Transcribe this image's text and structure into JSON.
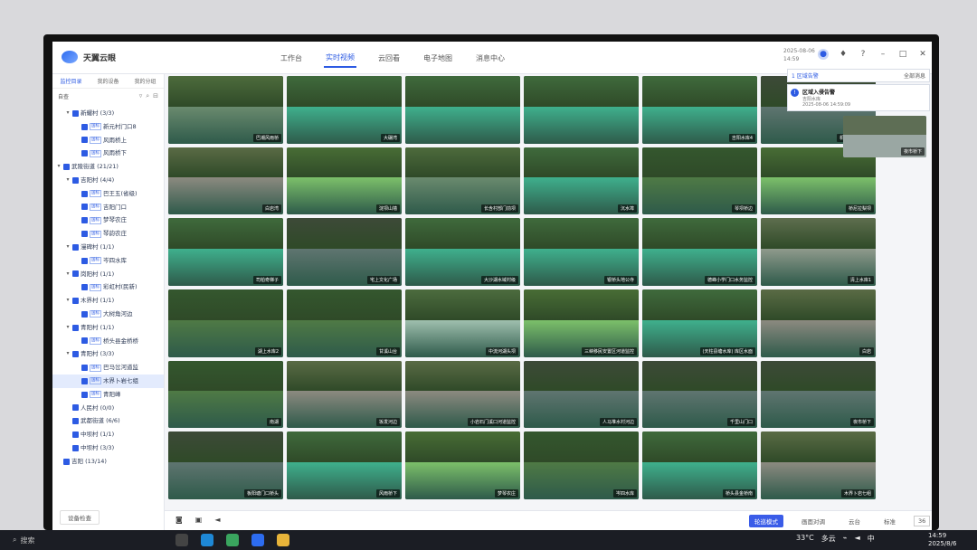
{
  "app": {
    "logo_text": "天翼云眼"
  },
  "nav": {
    "items": [
      {
        "label": "工作台"
      },
      {
        "label": "实时视频",
        "active": true
      },
      {
        "label": "云回看"
      },
      {
        "label": "电子地图"
      },
      {
        "label": "消息中心"
      }
    ]
  },
  "header": {
    "date": "2025-08-06",
    "time": "14:59"
  },
  "sidebar": {
    "tabs": [
      "监控目录",
      "我的设备",
      "我的分组"
    ],
    "search_label": "自查",
    "tree": [
      {
        "label": "新耀村 (3/3)",
        "level": 1,
        "caret": "▾"
      },
      {
        "label": "新元村门口8",
        "level": 2,
        "badge": "国标"
      },
      {
        "label": "风雨桥上",
        "level": 2,
        "badge": "国标"
      },
      {
        "label": "风雨桥下",
        "level": 2,
        "badge": "国标"
      },
      {
        "label": "武陵街道 (21/21)",
        "level": 0,
        "caret": "▾"
      },
      {
        "label": "吉阳村 (4/4)",
        "level": 1,
        "caret": "▾"
      },
      {
        "label": "巴王五(省级)",
        "level": 2,
        "badge": "国标"
      },
      {
        "label": "吉阳门口",
        "level": 2,
        "badge": "国标"
      },
      {
        "label": "梦琴农庄",
        "level": 2,
        "badge": "国标"
      },
      {
        "label": "琴韵农庄",
        "level": 2,
        "badge": "国标"
      },
      {
        "label": "漫碑村 (1/1)",
        "level": 1,
        "caret": "▾"
      },
      {
        "label": "岑四水库",
        "level": 2,
        "badge": "国标"
      },
      {
        "label": "岗阳村 (1/1)",
        "level": 1,
        "caret": "▾"
      },
      {
        "label": "彩虹村(民新)",
        "level": 2,
        "badge": "国标"
      },
      {
        "label": "木界村 (1/1)",
        "level": 1,
        "caret": "▾"
      },
      {
        "label": "大树角河边",
        "level": 2,
        "badge": "国标"
      },
      {
        "label": "青阳村 (1/1)",
        "level": 1,
        "caret": "▾"
      },
      {
        "label": "桥头县金桥桥",
        "level": 2,
        "badge": "国标"
      },
      {
        "label": "青阳村 (3/3)",
        "level": 1,
        "caret": "▾"
      },
      {
        "label": "巴马岔河道监",
        "level": 2,
        "badge": "国标"
      },
      {
        "label": "木界卜岩七组",
        "level": 2,
        "badge": "国标",
        "selected": true
      },
      {
        "label": "青阳峰",
        "level": 2,
        "badge": "国标"
      },
      {
        "label": "人民村 (0/0)",
        "level": 1
      },
      {
        "label": "武都街道 (6/6)",
        "level": 1
      },
      {
        "label": "中坝村 (1/1)",
        "level": 1
      },
      {
        "label": "中坝村 (3/3)",
        "level": 1
      },
      {
        "label": "吉阳 (13/14)",
        "level": 0
      }
    ],
    "footer": "设备检查"
  },
  "tiles": [
    {
      "caption": "巴潮风雨桥",
      "scene": "river"
    },
    {
      "caption": "大碾湾",
      "scene": "lake"
    },
    {
      "caption": "",
      "scene": "lake"
    },
    {
      "caption": "",
      "scene": "lake"
    },
    {
      "caption": "吉阳水库4",
      "scene": "lake"
    },
    {
      "caption": "机耕村河道监控",
      "scene": "dark"
    },
    {
      "caption": "白岩湾",
      "scene": "rock"
    },
    {
      "caption": "淀坝山墙",
      "scene": "green"
    },
    {
      "caption": "长含村部门前坝",
      "scene": "river"
    },
    {
      "caption": "沉水埠",
      "scene": "lake"
    },
    {
      "caption": "琴坝桥边",
      "scene": "forest"
    },
    {
      "caption": "桥尼拉梨坝",
      "scene": "green"
    },
    {
      "caption": "司柏奇梯子",
      "scene": "lake"
    },
    {
      "caption": "宅上文化广场",
      "scene": "dark"
    },
    {
      "caption": "大沙湖水域村级",
      "scene": "lake"
    },
    {
      "caption": "银桥头地公寺",
      "scene": "lake"
    },
    {
      "caption": "德峰小学门口水务监控",
      "scene": "lake"
    },
    {
      "caption": "清上水库1",
      "scene": "bridge"
    },
    {
      "caption": "湖上水库2",
      "scene": "forest"
    },
    {
      "caption": "甘溪山台",
      "scene": "forest"
    },
    {
      "caption": "中流河湖头坝",
      "scene": "dam"
    },
    {
      "caption": "三峡移民安置区河道监控",
      "scene": "green"
    },
    {
      "caption": "(天柱县塘水库) 库区水面",
      "scene": "lake"
    },
    {
      "caption": "白岩",
      "scene": "rock"
    },
    {
      "caption": "南湖",
      "scene": "forest"
    },
    {
      "caption": "坂发河边",
      "scene": "rock"
    },
    {
      "caption": "小岩石门溪口河道监控",
      "scene": "rock"
    },
    {
      "caption": "人马堆水村河边",
      "scene": "dark"
    },
    {
      "caption": "千里山门口",
      "scene": "dark"
    },
    {
      "caption": "夜市桥下",
      "scene": "dark"
    },
    {
      "caption": "板阳塘门口桥头",
      "scene": "dark"
    },
    {
      "caption": "风雨桥下",
      "scene": "lake"
    },
    {
      "caption": "梦琴农庄",
      "scene": "green"
    },
    {
      "caption": "岑四水库",
      "scene": "forest"
    },
    {
      "caption": "桥头县金桥南",
      "scene": "lake"
    },
    {
      "caption": "木界卜岩七组",
      "scene": "rock"
    }
  ],
  "notifications": {
    "tab": "1 区域告警",
    "all": "全部消息",
    "card": {
      "title": "区域入侵告警",
      "source": "吉阳水库",
      "time": "2025-08-06 14:59:09"
    },
    "side_tile_caption": "夜市桥下"
  },
  "bottombar": {
    "left_icons": [
      "camera-icon",
      "record-icon",
      "volume-icon"
    ],
    "buttons": [
      {
        "label": "轮巡模式",
        "primary": true
      },
      {
        "label": "画面对调"
      },
      {
        "label": "云台"
      },
      {
        "label": "标准"
      }
    ],
    "layout_count": "36"
  },
  "taskbar": {
    "search_placeholder": "搜索",
    "weather": "33°C",
    "weather_desc": "多云",
    "ime": "中",
    "clock_time": "14:59",
    "clock_date": "2025/8/6"
  },
  "colors": {
    "accent": "#2d5be3",
    "primary_button": "#3a5ce8"
  }
}
